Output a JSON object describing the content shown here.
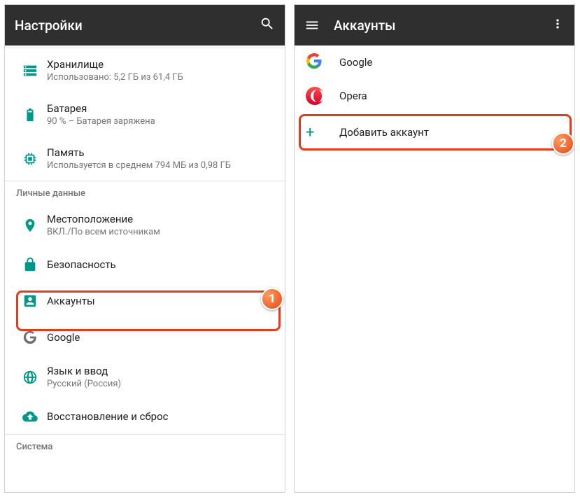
{
  "left": {
    "title": "Настройки",
    "storage": {
      "title": "Хранилище",
      "sub": "Использовано: 5,2 ГБ из 61,4 ГБ"
    },
    "battery": {
      "title": "Батарея",
      "sub": "90 % – Батарея заряжена"
    },
    "memory": {
      "title": "Память",
      "sub": "Используется в среднем 794 МБ из 0,98 ГБ"
    },
    "section_personal": "Личные данные",
    "location": {
      "title": "Местоположение",
      "sub": "ВКЛ./По всем источникам"
    },
    "security": {
      "title": "Безопасность"
    },
    "accounts": {
      "title": "Аккаунты"
    },
    "google": {
      "title": "Google"
    },
    "language": {
      "title": "Язык и ввод",
      "sub": "Русский (Россия)"
    },
    "backup": {
      "title": "Восстановление и сброс"
    },
    "section_system": "Система"
  },
  "right": {
    "title": "Аккаунты",
    "google": "Google",
    "opera": "Opera",
    "add": "Добавить аккаунт"
  },
  "annotations": {
    "b1": "1",
    "b2": "2"
  }
}
